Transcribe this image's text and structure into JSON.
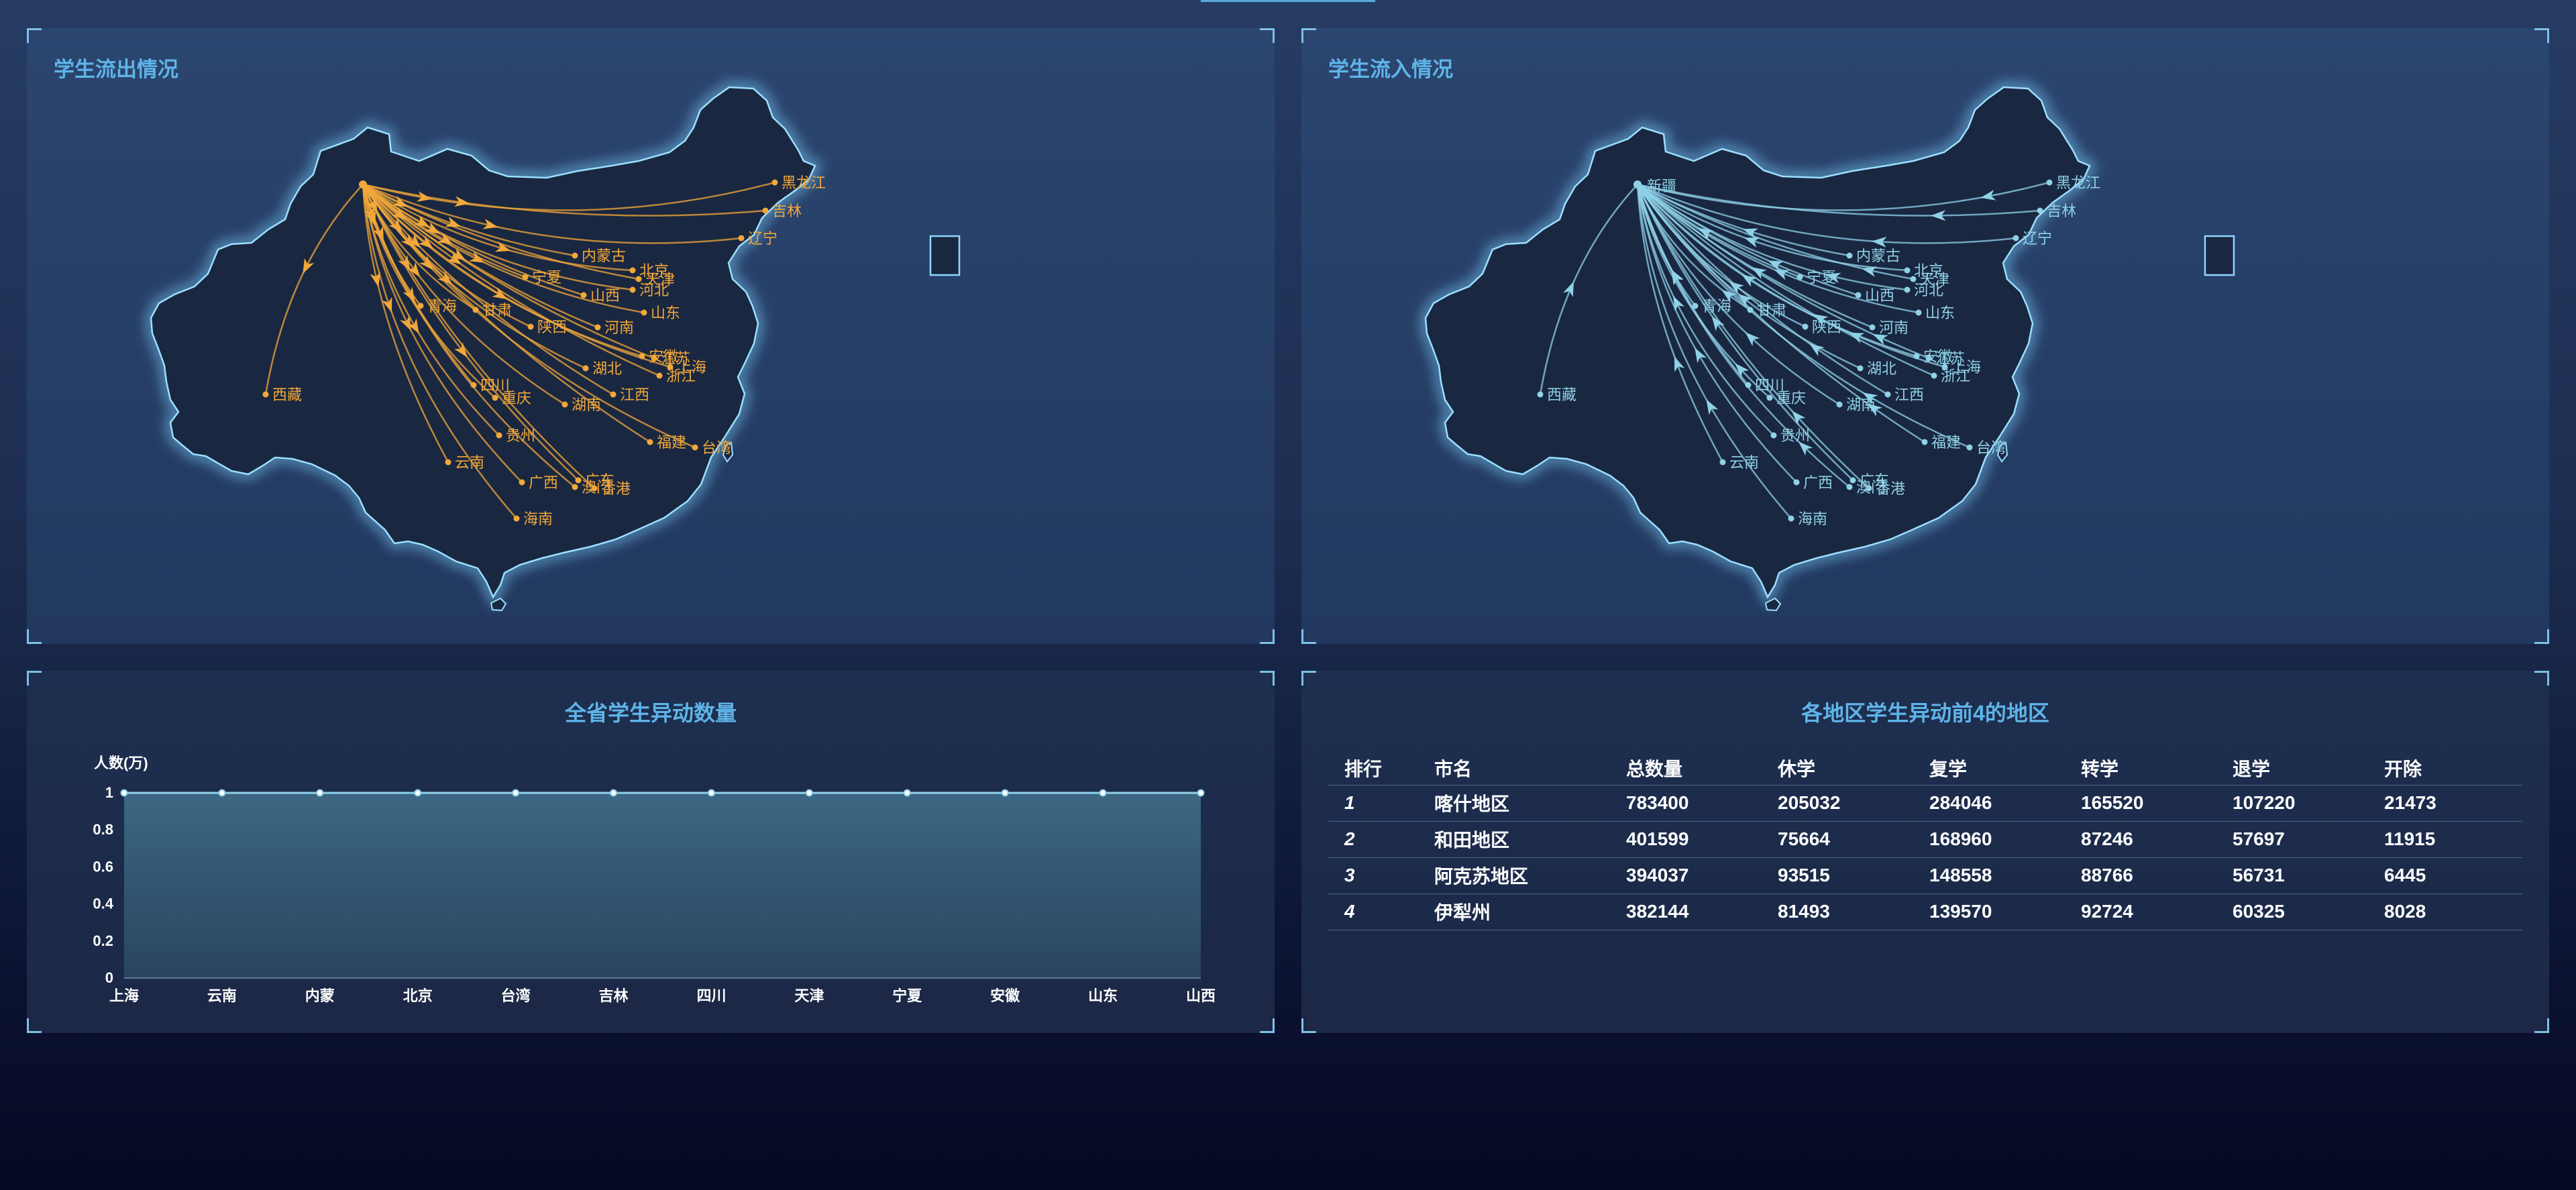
{
  "panels": {
    "outflow_title": "学生流出情况",
    "inflow_title": "学生流入情况",
    "line_title": "全省学生异动数量",
    "table_title": "各地区学生异动前4的地区"
  },
  "colors": {
    "outflow": "#f2a83a",
    "inflow": "#8fd2e8",
    "accent": "#5fb4e8",
    "map_fill": "#1a2740",
    "map_glow": "#7fd3ff"
  },
  "maps": {
    "origin": "新疆",
    "provinces": [
      "黑龙江",
      "吉林",
      "辽宁",
      "内蒙古",
      "北京",
      "天津",
      "河北",
      "山西",
      "山东",
      "宁夏",
      "甘肃",
      "青海",
      "陕西",
      "河南",
      "安徽",
      "江苏",
      "上海",
      "浙江",
      "湖北",
      "四川",
      "重庆",
      "江西",
      "湖南",
      "西藏",
      "贵州",
      "福建",
      "台湾",
      "云南",
      "广西",
      "广东",
      "澳门",
      "香港",
      "海南"
    ]
  },
  "chart_data": {
    "type": "line",
    "title": "全省学生异动数量",
    "ylabel": "人数(万)",
    "xlabel": "",
    "categories": [
      "上海",
      "云南",
      "内蒙",
      "北京",
      "台湾",
      "吉林",
      "四川",
      "天津",
      "宁夏",
      "安徽",
      "山东",
      "山西"
    ],
    "series": [
      {
        "values": [
          1,
          1,
          1,
          1,
          1,
          1,
          1,
          1,
          1,
          1,
          1,
          1
        ]
      }
    ],
    "ylim": [
      0,
      1
    ],
    "yticks": [
      "0",
      "0.2",
      "0.4",
      "0.6",
      "0.8",
      "1"
    ],
    "grid": false,
    "area_fill": true
  },
  "table": {
    "headers": [
      "排行",
      "市名",
      "总数量",
      "休学",
      "复学",
      "转学",
      "退学",
      "开除"
    ],
    "rows": [
      [
        "1",
        "喀什地区",
        "783400",
        "205032",
        "284046",
        "165520",
        "107220",
        "21473"
      ],
      [
        "2",
        "和田地区",
        "401599",
        "75664",
        "168960",
        "87246",
        "57697",
        "11915"
      ],
      [
        "3",
        "阿克苏地区",
        "394037",
        "93515",
        "148558",
        "88766",
        "56731",
        "6445"
      ],
      [
        "4",
        "伊犁州",
        "382144",
        "81493",
        "139570",
        "92724",
        "60325",
        "8028"
      ]
    ]
  }
}
